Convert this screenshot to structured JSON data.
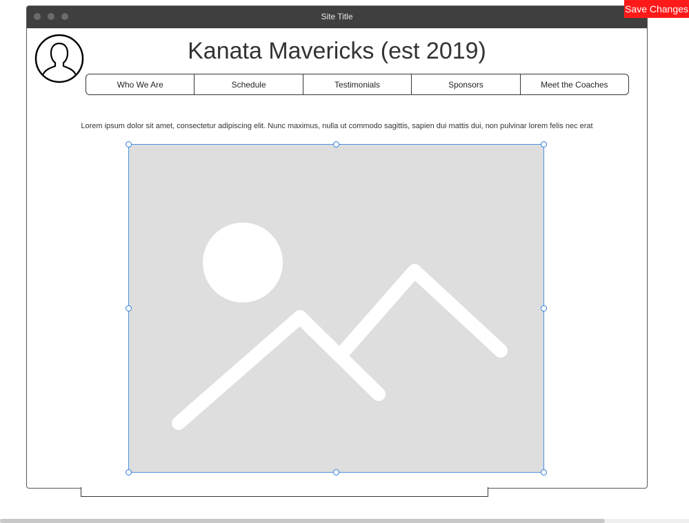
{
  "window": {
    "title": "Site Title"
  },
  "header": {
    "avatar_icon": "user-profile-icon",
    "heading": "Kanata Mavericks (est 2019)"
  },
  "nav": {
    "items": [
      {
        "label": "Who We Are"
      },
      {
        "label": "Schedule"
      },
      {
        "label": "Testimonials"
      },
      {
        "label": "Sponsors"
      },
      {
        "label": "Meet the Coaches"
      }
    ]
  },
  "content": {
    "lorem": "Lorem ipsum dolor sit amet, consectetur adipiscing elit. Nunc maximus, nulla ut commodo sagittis, sapien dui mattis dui, non pulvinar lorem felis nec erat",
    "image_icon": "image-placeholder-icon"
  },
  "toolbar": {
    "save_label": "Save Changes"
  },
  "colors": {
    "save_button": "#ff1a1a",
    "selection": "#2b7bd8",
    "titlebar": "#3f3f3f",
    "image_bg": "#dedede"
  }
}
